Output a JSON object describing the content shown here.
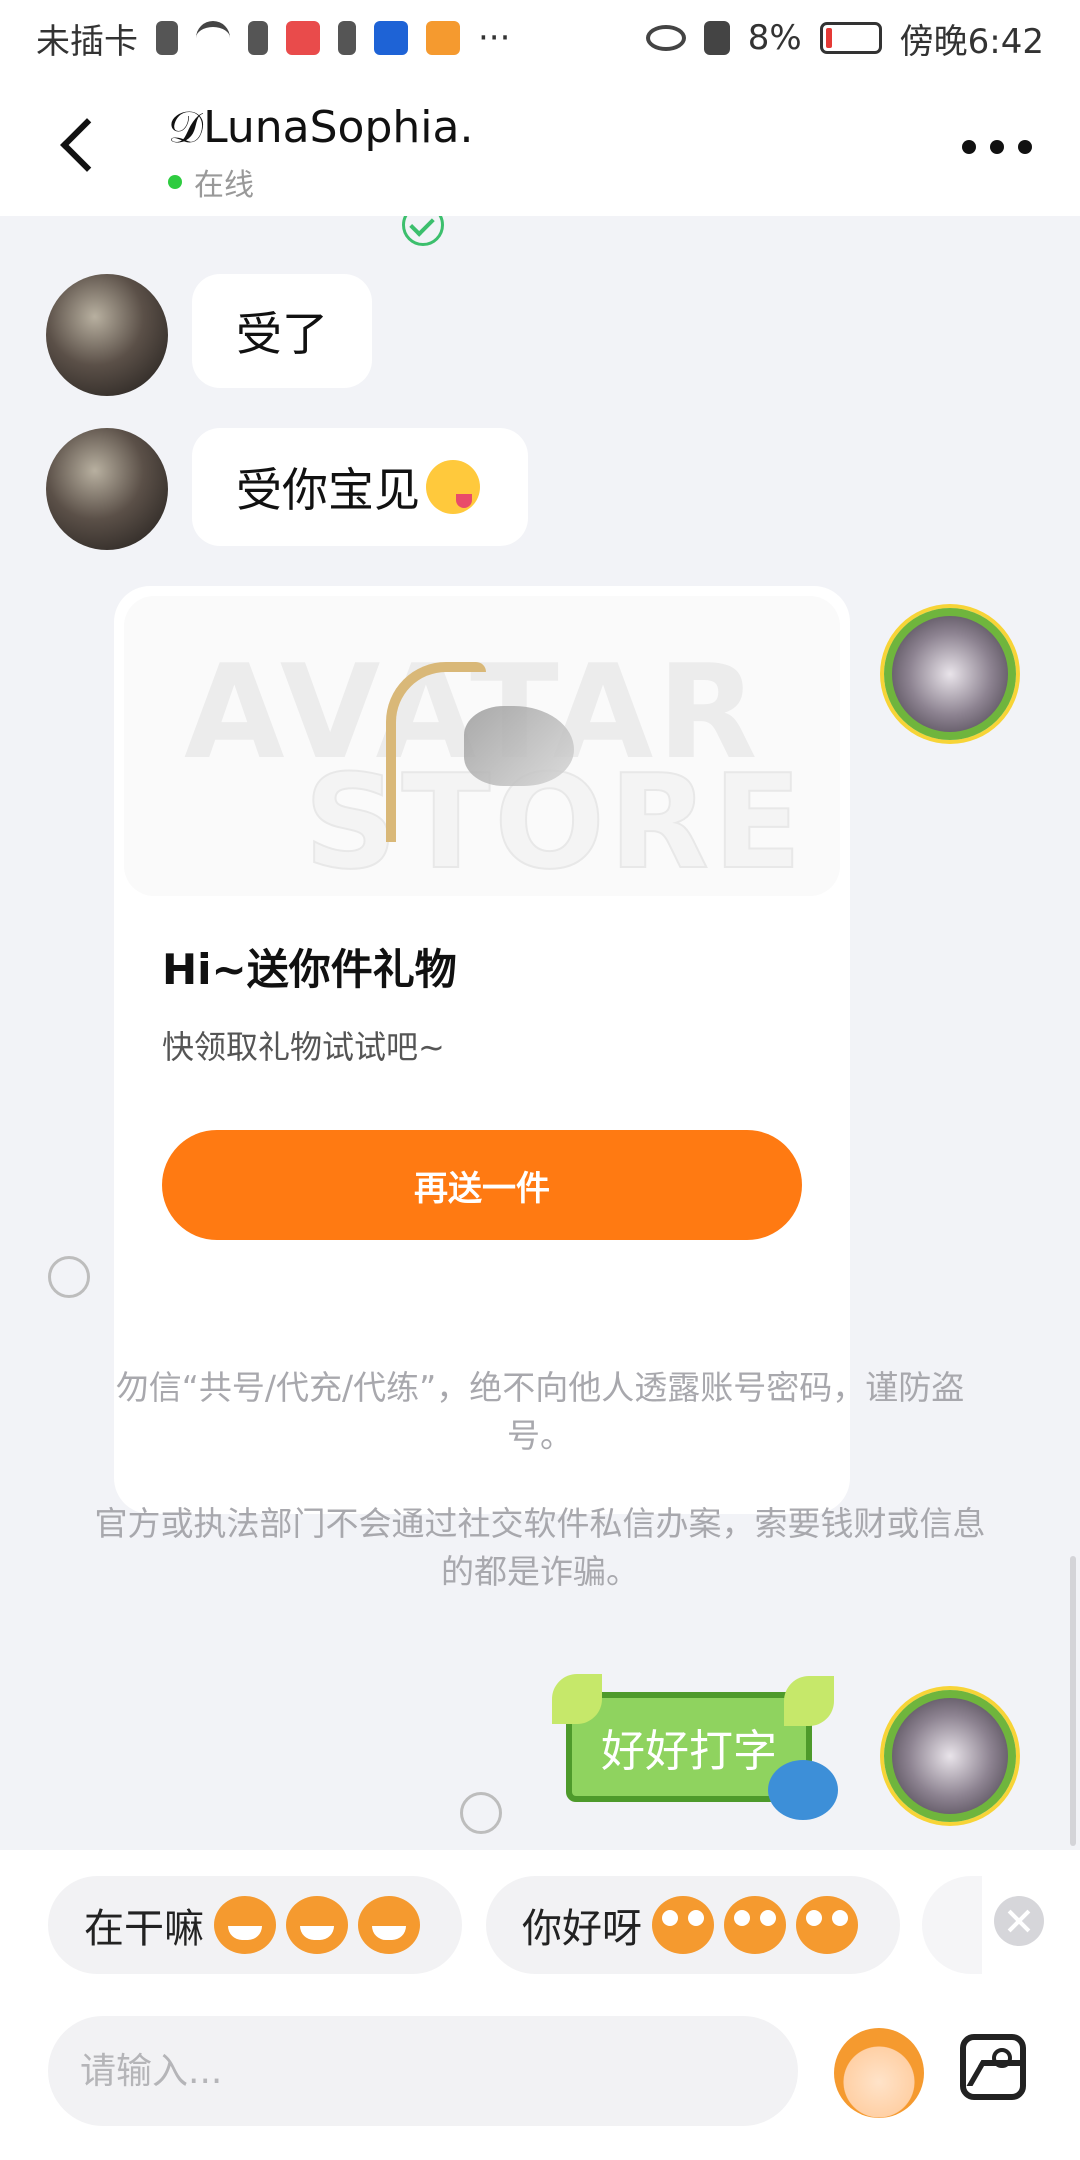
{
  "status_bar": {
    "carrier": "未插卡",
    "battery": "8%",
    "time": "傍晚6:42"
  },
  "header": {
    "name": "𝒟LunaSophia.",
    "status": "在线"
  },
  "messages": [
    {
      "text": "受了"
    },
    {
      "text": "受你宝见"
    }
  ],
  "gift_card": {
    "title": "Hi~送你件礼物",
    "subtitle": "快领取礼物试试吧~",
    "button": "再送一件"
  },
  "notices": [
    "勿信“共号/代充/代练”，绝不向他人透露账号密码，谨防盗号。",
    "官方或执法部门不会通过社交软件私信办案，索要钱财或信息的都是诈骗。"
  ],
  "sticker": {
    "text": "好好打字"
  },
  "quick_replies": [
    {
      "text": "在干嘛"
    },
    {
      "text": "你好呀"
    }
  ],
  "input": {
    "placeholder": "请输入..."
  },
  "colors": {
    "accent": "#ff7a12",
    "online": "#2ecc40",
    "background": "#f2f3f7"
  }
}
